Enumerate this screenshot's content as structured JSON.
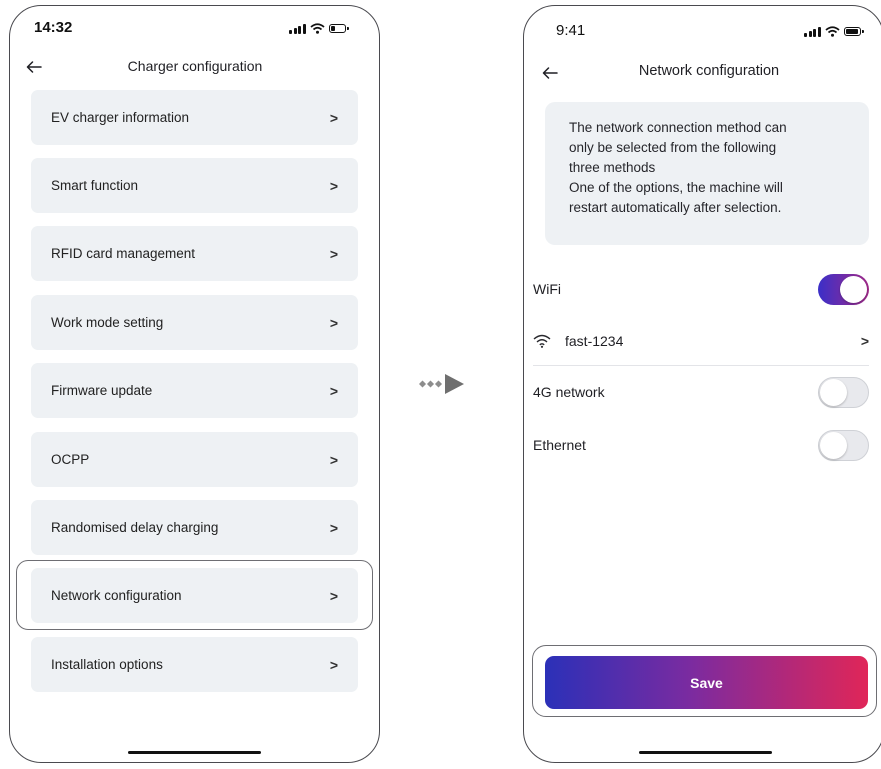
{
  "left_phone": {
    "time": "14:32",
    "title": "Charger configuration",
    "items": [
      {
        "label": "EV charger information",
        "chevron": ">"
      },
      {
        "label": "Smart function",
        "chevron": ">"
      },
      {
        "label": "RFID card management",
        "chevron": ">"
      },
      {
        "label": "Work mode setting",
        "chevron": ">"
      },
      {
        "label": "Firmware update",
        "chevron": ">"
      },
      {
        "label": "OCPP",
        "chevron": ">"
      },
      {
        "label": "Randomised delay charging",
        "chevron": ">"
      },
      {
        "label": "Network configuration",
        "chevron": ">",
        "highlighted": true
      },
      {
        "label": "Installation options",
        "chevron": ">"
      }
    ]
  },
  "right_phone": {
    "time": "9:41",
    "title": "Network configuration",
    "info_lines": [
      "The network connection method can",
      "only be selected from the following",
      "three methods",
      "One of the options, the machine will",
      "restart automatically after selection."
    ],
    "wifi": {
      "label": "WiFi",
      "enabled": true
    },
    "wifi_network": {
      "name": "fast-1234",
      "chevron": ">"
    },
    "network_4g": {
      "label": "4G network",
      "enabled": false
    },
    "ethernet": {
      "label": "Ethernet",
      "enabled": false
    },
    "save_label": "Save"
  },
  "colors": {
    "accent_start": "#2b30b8",
    "accent_end": "#e02658",
    "toggle_on_start": "#3b2fc8",
    "toggle_on_end": "#a22a8a",
    "menu_bg": "#eef1f4"
  },
  "icons": [
    "back-arrow-icon",
    "chevron-right-icon",
    "wifi-icon",
    "signal-icon",
    "battery-icon",
    "arrow-connector-icon"
  ]
}
